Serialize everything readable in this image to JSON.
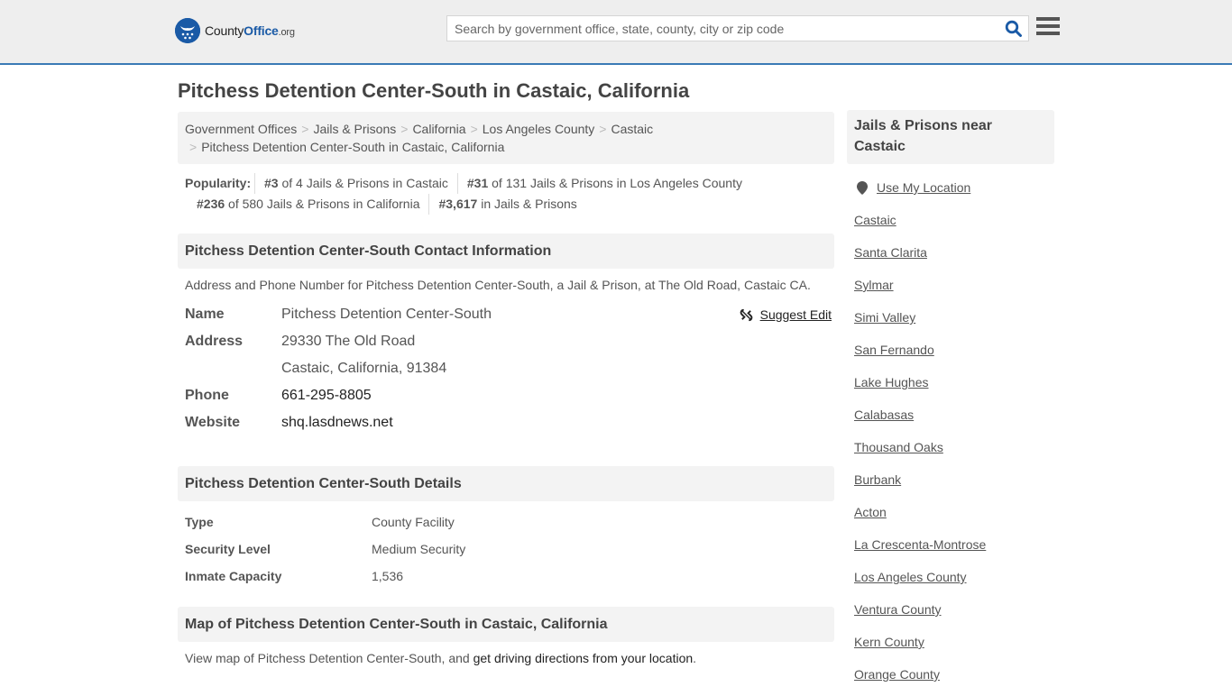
{
  "header": {
    "logo": {
      "name_part1": "County",
      "name_part2": "Office",
      "name_part3": ".org"
    },
    "search": {
      "placeholder": "Search by government office, state, county, city or zip code",
      "value": ""
    },
    "search_icon": "search-icon",
    "menu_icon": "hamburger-menu-icon"
  },
  "page": {
    "title": "Pitchess Detention Center-South in Castaic, California"
  },
  "breadcrumb": {
    "items": [
      "Government Offices",
      "Jails & Prisons",
      "California",
      "Los Angeles County",
      "Castaic"
    ],
    "current": "Pitchess Detention Center-South in Castaic, California",
    "separator": ">"
  },
  "popularity": {
    "label": "Popularity:",
    "items": [
      {
        "rank": "#3",
        "text": "of 4 Jails & Prisons in Castaic"
      },
      {
        "rank": "#31",
        "text": "of 131 Jails & Prisons in Los Angeles County"
      },
      {
        "rank": "#236",
        "text": "of 580 Jails & Prisons in California"
      },
      {
        "rank": "#3,617",
        "text": "in Jails & Prisons"
      }
    ]
  },
  "contact": {
    "heading": "Pitchess Detention Center-South Contact Information",
    "description": "Address and Phone Number for Pitchess Detention Center-South, a Jail & Prison, at The Old Road, Castaic CA.",
    "suggest_edit": "Suggest Edit",
    "rows": {
      "name": {
        "label": "Name",
        "value": "Pitchess Detention Center-South"
      },
      "address": {
        "label": "Address",
        "line1": "29330 The Old Road",
        "line2": "Castaic, California, 91384"
      },
      "phone": {
        "label": "Phone",
        "value": "661-295-8805"
      },
      "website": {
        "label": "Website",
        "value": "shq.lasdnews.net"
      }
    }
  },
  "details": {
    "heading": "Pitchess Detention Center-South Details",
    "rows": [
      {
        "label": "Type",
        "value": "County Facility"
      },
      {
        "label": "Security Level",
        "value": "Medium Security"
      },
      {
        "label": "Inmate Capacity",
        "value": "1,536"
      }
    ]
  },
  "map": {
    "heading": "Map of Pitchess Detention Center-South in Castaic, California",
    "desc_prefix": "View map of Pitchess Detention Center-South, and ",
    "desc_link": "get driving directions from your location",
    "desc_suffix": "."
  },
  "sidebar": {
    "heading": "Jails & Prisons near Castaic",
    "use_location": "Use My Location",
    "links": [
      "Castaic",
      "Santa Clarita",
      "Sylmar",
      "Simi Valley",
      "San Fernando",
      "Lake Hughes",
      "Calabasas",
      "Thousand Oaks",
      "Burbank",
      "Acton",
      "La Crescenta-Montrose",
      "Los Angeles County",
      "Ventura County",
      "Kern County",
      "Orange County"
    ]
  },
  "colors": {
    "brand_blue": "#1a5aa6",
    "header_border": "#3a7ab5",
    "header_bg": "#eeeeee",
    "panel_bg": "#f3f3f3"
  }
}
